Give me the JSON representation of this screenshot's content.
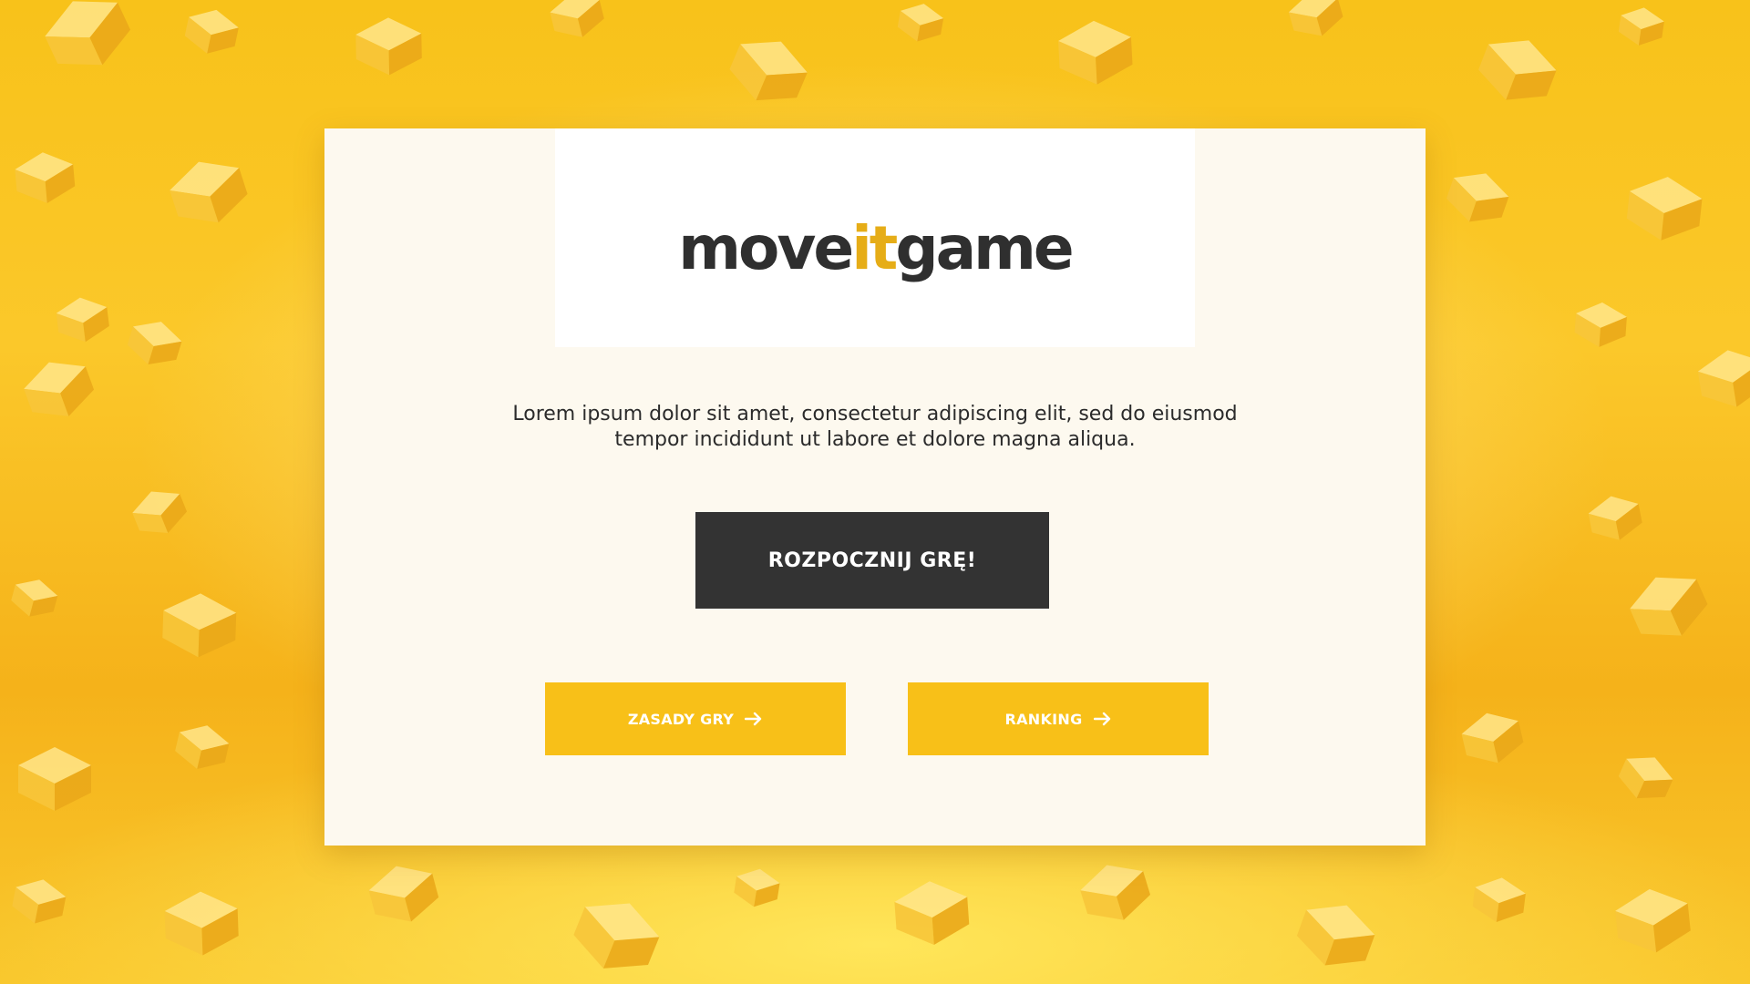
{
  "logo": {
    "part1": "move",
    "part2": "it",
    "part3": "game"
  },
  "intro_text": "Lorem ipsum dolor sit amet, consectetur adipiscing elit, sed do eiusmod tempor incididunt ut labore et dolore magna aliqua.",
  "buttons": {
    "start_label": "ROZPOCZNIJ GRĘ!",
    "rules_label": "ZASADY GRY",
    "ranking_label": "RANKING"
  },
  "icons": {
    "rules_arrow": "arrow-right-icon",
    "ranking_arrow": "arrow-right-icon"
  },
  "colors": {
    "brand_yellow": "#f8c018",
    "accent_logo": "#e6ad17",
    "dark_button": "#333333",
    "panel_background": "#fdf9ef",
    "text_dark": "#2f2f2f"
  }
}
